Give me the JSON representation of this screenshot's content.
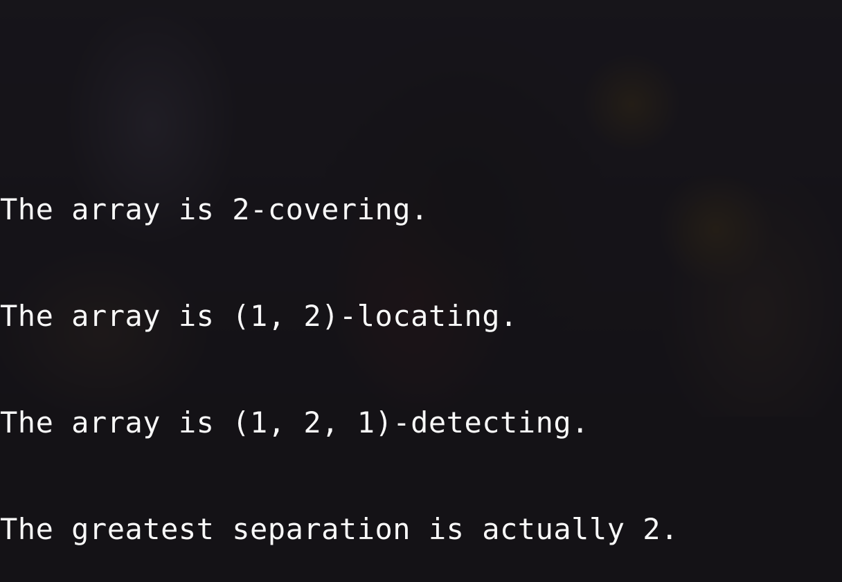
{
  "output": {
    "lines": [
      "The array is 2-covering.",
      "The array is (1, 2)-locating.",
      "The array is (1, 2, 1)-detecting.",
      "The greatest separation is actually 2."
    ]
  }
}
